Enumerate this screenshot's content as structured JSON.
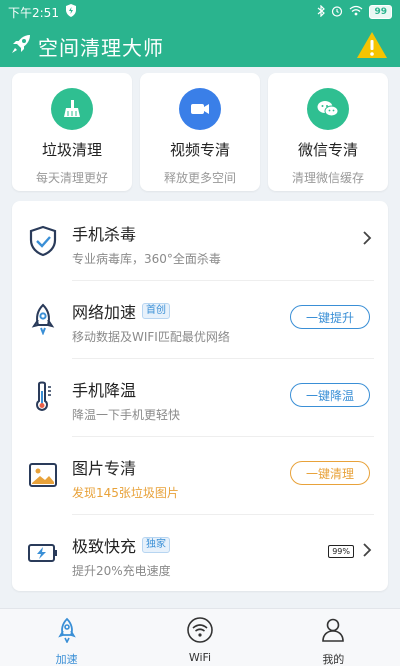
{
  "status": {
    "time": "下午2:51",
    "battery": "99"
  },
  "header": {
    "title": "空间清理大师"
  },
  "top_cards": [
    {
      "title": "垃圾清理",
      "subtitle": "每天清理更好"
    },
    {
      "title": "视频专清",
      "subtitle": "释放更多空间"
    },
    {
      "title": "微信专清",
      "subtitle": "清理微信缓存"
    }
  ],
  "list": [
    {
      "title": "手机杀毒",
      "subtitle": "专业病毒库，360°全面杀毒"
    },
    {
      "title": "网络加速",
      "tag": "首创",
      "subtitle": "移动数据及WIFI匹配最优网络",
      "button": "一键提升"
    },
    {
      "title": "手机降温",
      "subtitle": "降温一下手机更轻快",
      "button": "一键降温"
    },
    {
      "title": "图片专清",
      "subtitle": "发现145张垃圾图片",
      "button": "一键清理"
    },
    {
      "title": "极致快充",
      "tag": "独家",
      "subtitle": "提升20%充电速度",
      "battery": "99%"
    }
  ],
  "tabs": [
    {
      "label": "加速"
    },
    {
      "label": "WiFi"
    },
    {
      "label": "我的"
    }
  ],
  "colors": {
    "brand": "#2ab48e",
    "accent_blue": "#3a8fd6",
    "accent_orange": "#e8a23a",
    "warning": "#f5c400"
  }
}
